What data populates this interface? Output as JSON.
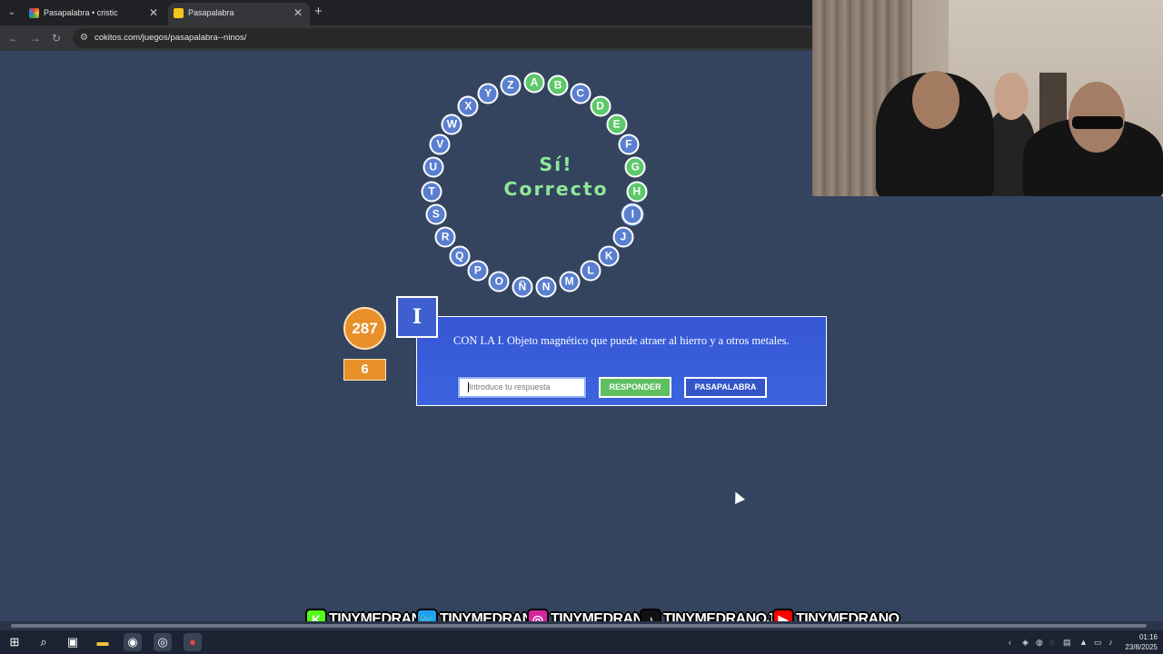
{
  "browser": {
    "tabs": [
      {
        "title": "Pasapalabra • cristic",
        "active": false,
        "favicon": "colorful-icon"
      },
      {
        "title": "Pasapalabra",
        "active": true,
        "favicon": "cokitos-icon"
      }
    ],
    "url": "cokitos.com/juegos/pasapalabra--ninos/",
    "close_glyph": "✕",
    "new_tab_glyph": "+"
  },
  "game": {
    "feedback_line1": "Sí!",
    "feedback_line2": "Correcto",
    "letters": [
      {
        "letter": "A",
        "state": "correct"
      },
      {
        "letter": "B",
        "state": "correct"
      },
      {
        "letter": "C",
        "state": "pending"
      },
      {
        "letter": "D",
        "state": "correct"
      },
      {
        "letter": "E",
        "state": "correct"
      },
      {
        "letter": "F",
        "state": "pending"
      },
      {
        "letter": "G",
        "state": "correct"
      },
      {
        "letter": "H",
        "state": "correct"
      },
      {
        "letter": "I",
        "state": "current"
      },
      {
        "letter": "J",
        "state": "pending"
      },
      {
        "letter": "K",
        "state": "pending"
      },
      {
        "letter": "L",
        "state": "pending"
      },
      {
        "letter": "M",
        "state": "pending"
      },
      {
        "letter": "N",
        "state": "pending"
      },
      {
        "letter": "Ñ",
        "state": "pending"
      },
      {
        "letter": "O",
        "state": "pending"
      },
      {
        "letter": "P",
        "state": "pending"
      },
      {
        "letter": "Q",
        "state": "pending"
      },
      {
        "letter": "R",
        "state": "pending"
      },
      {
        "letter": "S",
        "state": "pending"
      },
      {
        "letter": "T",
        "state": "pending"
      },
      {
        "letter": "U",
        "state": "pending"
      },
      {
        "letter": "V",
        "state": "pending"
      },
      {
        "letter": "W",
        "state": "pending"
      },
      {
        "letter": "X",
        "state": "pending"
      },
      {
        "letter": "Y",
        "state": "pending"
      },
      {
        "letter": "Z",
        "state": "pending"
      }
    ],
    "time_remaining": "287",
    "correct_count": "6",
    "current_letter": "I",
    "question": "CON LA I. Objeto magnético que puede atraer al hierro y a otros metales.",
    "answer_placeholder": "Introduce tu respuesta",
    "answer_value": "",
    "respond_label": "RESPONDER",
    "pass_label": "PASAPALABRA"
  },
  "overlay": {
    "socials": [
      {
        "platform": "kick",
        "icon": "kick-icon",
        "glyph": "K",
        "handle": "TINYMEDRANO",
        "color": "#53fc18"
      },
      {
        "platform": "twitter",
        "icon": "twitter-icon",
        "glyph": "🐦",
        "handle": "TINYMEDRANO",
        "color": "#1da1f2"
      },
      {
        "platform": "instagram",
        "icon": "instagram-icon",
        "glyph": "◎",
        "handle": "TINYMEDRANO",
        "color": "#d6249f"
      },
      {
        "platform": "tiktok",
        "icon": "tiktok-icon",
        "glyph": "♪",
        "handle": "TINYMEDRANOJR",
        "color": "#111111"
      },
      {
        "platform": "youtube",
        "icon": "youtube-icon",
        "glyph": "▶",
        "handle": "TINYMEDRANO",
        "color": "#ff0000"
      }
    ]
  },
  "taskbar": {
    "time": "01:16",
    "date": "23/8/2025"
  },
  "colors": {
    "page_background": "#35445e",
    "pending_letter": "#5a7fcf",
    "correct_letter": "#5dc86a",
    "feedback_text": "#8ee89a",
    "timer": "#e8902a",
    "question_panel": "#3657d4",
    "respond_button": "#5dbf5f"
  }
}
